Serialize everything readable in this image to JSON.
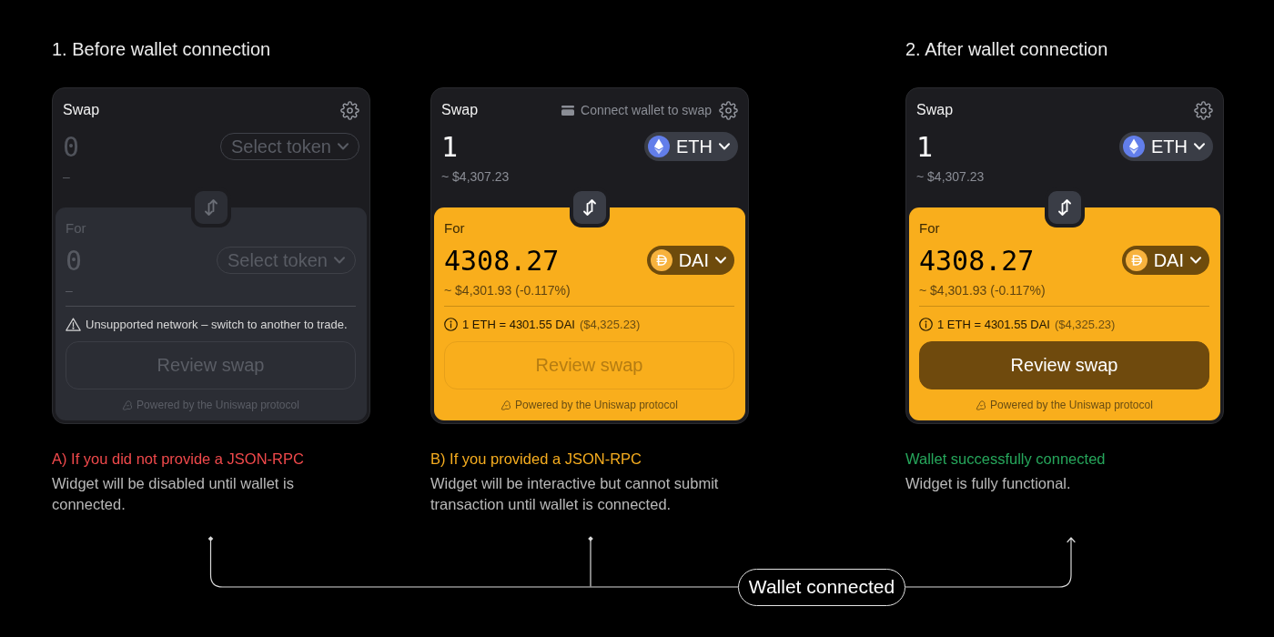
{
  "columns": [
    {
      "heading": "1. Before wallet connection",
      "widget": {
        "title": "Swap",
        "disabled": true,
        "input": {
          "amount": {
            "placeholder": "0"
          },
          "token": {
            "kind": "select",
            "label": "Select token"
          },
          "usd": "–"
        },
        "output": {
          "label": "For",
          "amount": {
            "placeholder": "0"
          },
          "token": {
            "kind": "select",
            "label": "Select token"
          },
          "usd": "–"
        },
        "notice": {
          "kind": "warning",
          "text": "Unsupported network – switch to another to trade."
        },
        "review_button": {
          "label": "Review swap",
          "disabled": true
        },
        "footer": "Powered by the Uniswap protocol"
      },
      "caption": {
        "title": "A) If you did not provide a JSON-RPC",
        "color": "#f0494b",
        "text": "Widget will be disabled until wallet is connected."
      }
    },
    {
      "widget": {
        "title": "Swap",
        "disabled": false,
        "wallet_prompt": "Connect wallet to swap",
        "input": {
          "amount": {
            "value": "1"
          },
          "token": {
            "kind": "eth",
            "label": "ETH"
          },
          "usd": "~ $4,307.23"
        },
        "output": {
          "label": "For",
          "amount": {
            "value": "4308.27"
          },
          "token": {
            "kind": "dai",
            "label": "DAI"
          },
          "usd": "~ $4,301.93 (-0.117%)"
        },
        "notice": {
          "kind": "rate",
          "text": "1 ETH = 4301.55 DAI",
          "detail": "($4,325.23)"
        },
        "review_button": {
          "label": "Review swap",
          "disabled": true
        },
        "footer": "Powered by the Uniswap protocol"
      },
      "caption": {
        "title": "B) If you provided a JSON-RPC",
        "color": "#f6ad1f",
        "text": "Widget will be interactive but cannot submit transaction until wallet is connected."
      }
    },
    {
      "heading": "2. After wallet connection",
      "widget": {
        "title": "Swap",
        "disabled": false,
        "input": {
          "amount": {
            "value": "1"
          },
          "token": {
            "kind": "eth",
            "label": "ETH"
          },
          "usd": "~ $4,307.23"
        },
        "output": {
          "label": "For",
          "amount": {
            "value": "4308.27"
          },
          "token": {
            "kind": "dai",
            "label": "DAI"
          },
          "usd": "~ $4,301.93 (-0.117%)"
        },
        "notice": {
          "kind": "rate",
          "text": "1 ETH = 4301.55 DAI",
          "detail": "($4,325.23)"
        },
        "review_button": {
          "label": "Review swap",
          "disabled": false
        },
        "footer": "Powered by the Uniswap protocol"
      },
      "caption": {
        "title": "Wallet successfully connected",
        "color": "#26a65b",
        "text": "Widget is fully functional."
      }
    }
  ],
  "connector": {
    "label": "Wallet connected"
  }
}
